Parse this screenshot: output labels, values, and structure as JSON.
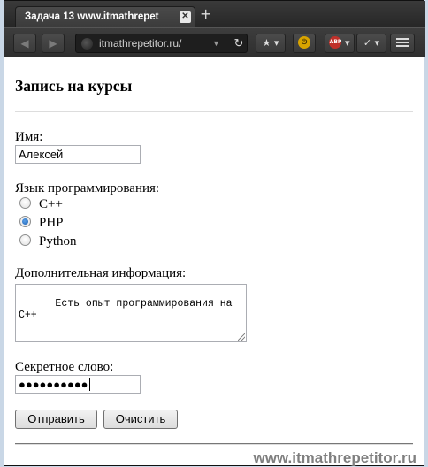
{
  "browser": {
    "tab_title": "Задача 13 www.itmathrepet",
    "tab_close": "✕",
    "new_tab": "+",
    "back": "◀",
    "forward": "▶",
    "url": "itmathrepetitor.ru/",
    "url_dropdown": "▼",
    "reload": "↻",
    "bookmark": "★",
    "dropdown": "▾",
    "addon1": "⏻",
    "adblock": "ABP",
    "addon3": "✓"
  },
  "form": {
    "title": "Запись на курсы",
    "name_label": "Имя:",
    "name_value": "Алексей",
    "lang_label": "Язык программирования:",
    "languages": [
      {
        "label": "C++",
        "checked": false
      },
      {
        "label": "PHP",
        "checked": true
      },
      {
        "label": "Python",
        "checked": false
      }
    ],
    "info_label": "Дополнительная информация:",
    "info_value": "Есть опыт программирования на\nC++",
    "secret_label": "Секретное слово:",
    "secret_value": "●●●●●●●●●●",
    "submit_label": "Отправить",
    "reset_label": "Очистить"
  },
  "watermark": "www.itmathrepetitor.ru"
}
